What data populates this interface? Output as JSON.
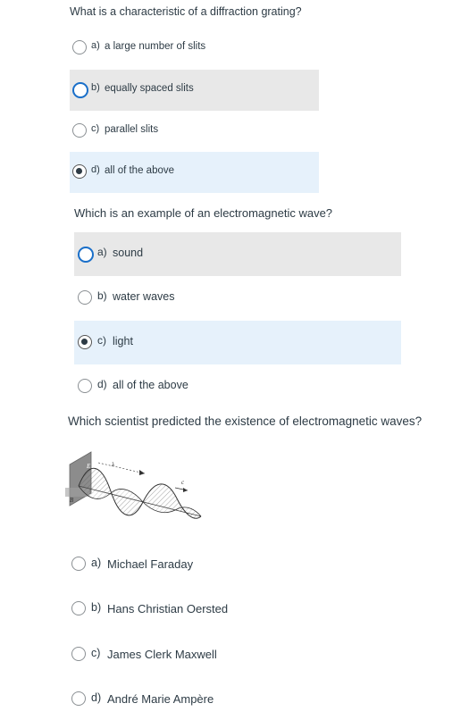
{
  "questions": [
    {
      "prompt": "What is a characteristic of a diffraction grating?",
      "options": [
        {
          "letter": "a)",
          "text": "a large number of slits",
          "state": "normal"
        },
        {
          "letter": "b)",
          "text": "equally spaced slits",
          "state": "hover-focus"
        },
        {
          "letter": "c)",
          "text": "parallel slits",
          "state": "normal"
        },
        {
          "letter": "d)",
          "text": "all of the above",
          "state": "selected"
        }
      ]
    },
    {
      "prompt": "Which is an example of an electromagnetic wave?",
      "options": [
        {
          "letter": "a)",
          "text": "sound",
          "state": "hover-focus"
        },
        {
          "letter": "b)",
          "text": "water waves",
          "state": "normal"
        },
        {
          "letter": "c)",
          "text": "light",
          "state": "selected"
        },
        {
          "letter": "d)",
          "text": "all of the above",
          "state": "normal"
        }
      ]
    },
    {
      "prompt": "Which scientist predicted the existence of electromagnetic waves?",
      "figure": {
        "labels": {
          "e": "E",
          "lambda": "λ",
          "c": "c",
          "b": "B"
        }
      },
      "options": [
        {
          "letter": "a)",
          "text": "Michael Faraday",
          "state": "normal"
        },
        {
          "letter": "b)",
          "text": "Hans Christian Oersted",
          "state": "normal"
        },
        {
          "letter": "c)",
          "text": "James Clerk Maxwell",
          "state": "normal"
        },
        {
          "letter": "d)",
          "text": "André Marie Ampère",
          "state": "normal"
        }
      ]
    }
  ],
  "colors": {
    "hover": "#e8e8e8",
    "selected": "#e6f1fb",
    "focus_ring": "#1a6fc9",
    "text": "#2d3b45"
  }
}
